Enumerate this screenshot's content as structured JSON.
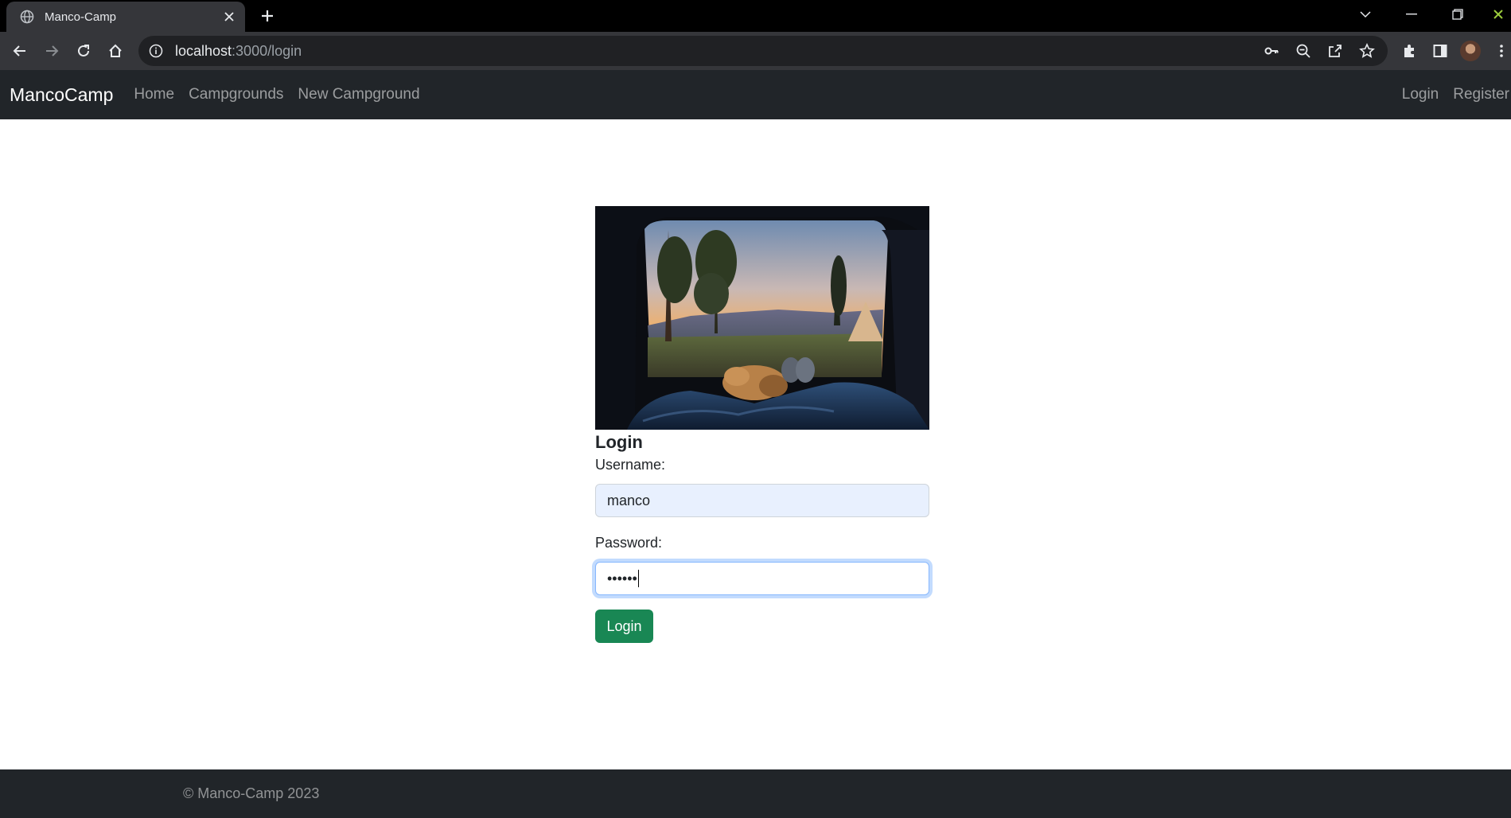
{
  "browser": {
    "tab_title": "Manco-Camp",
    "url_host": "localhost",
    "url_rest": ":3000/login",
    "icons": {
      "favicon": "globe-icon",
      "close": "close-icon",
      "new_tab": "plus-icon",
      "back": "back-arrow-icon",
      "forward": "forward-arrow-icon",
      "reload": "reload-icon",
      "home": "home-icon",
      "site_info": "info-icon",
      "password": "key-icon",
      "zoom": "zoom-out-icon",
      "share": "share-icon",
      "bookmark": "star-icon",
      "extensions": "puzzle-icon",
      "side_panel": "side-panel-icon",
      "profile": "avatar",
      "menu": "kebab-menu-icon"
    }
  },
  "navbar": {
    "brand": "MancoCamp",
    "links": [
      "Home",
      "Campgrounds",
      "New Campground"
    ],
    "right_links": [
      "Login",
      "Register"
    ]
  },
  "login": {
    "title": "Login",
    "username_label": "Username:",
    "username_value": "manco",
    "password_label": "Password:",
    "password_value": "••••••",
    "submit_label": "Login",
    "image_alt": "campsite-view-from-car-trunk"
  },
  "footer": {
    "copyright": "© Manco-Camp 2023"
  },
  "colors": {
    "navbar_bg": "#212529",
    "button_success": "#198754",
    "autofill_bg": "#e8f0fe",
    "focus_ring": "#86b7fe"
  }
}
